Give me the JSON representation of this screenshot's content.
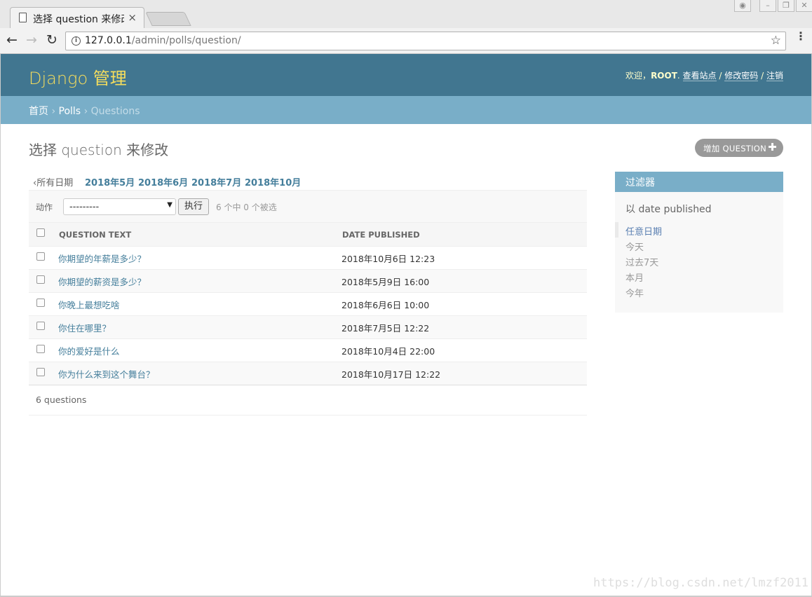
{
  "browser": {
    "tab_title": "选择 question 来修改",
    "tab_close": "×",
    "url_host": "127.0.0.1",
    "url_path": "/admin/polls/question/",
    "info_glyph": "i",
    "back_glyph": "←",
    "forward_glyph": "→",
    "reload_glyph": "↻",
    "star_glyph": "☆",
    "menu_glyph": "⋮",
    "window_controls": {
      "profile": "◉",
      "minimize": "–",
      "maximize": "❐",
      "close": "✕"
    }
  },
  "header": {
    "brand": "Django 管理",
    "welcome": "欢迎，",
    "username": "ROOT",
    "sep_dot": ".",
    "view_site": "查看站点",
    "sep1": "/",
    "change_password": "修改密码",
    "sep2": "/",
    "logout": "注销"
  },
  "breadcrumbs": {
    "home": "首页",
    "sep": "›",
    "app": "Polls",
    "current": "Questions"
  },
  "page": {
    "title": "选择 question 来修改",
    "add_button": "增加 QUESTION",
    "add_icon": "✚"
  },
  "date_hierarchy": {
    "all": "‹所有日期",
    "months": [
      "2018年5月",
      "2018年6月",
      "2018年7月",
      "2018年10月"
    ]
  },
  "actions": {
    "label": "动作",
    "select_value": "---------",
    "caret": "▼",
    "go_button": "执行",
    "counter": "6 个中 0 个被选"
  },
  "table": {
    "columns": [
      "QUESTION TEXT",
      "DATE PUBLISHED"
    ],
    "rows": [
      {
        "question": "你期望的年薪是多少？",
        "date": "2018年10月6日 12:23"
      },
      {
        "question": "你期望的薪资是多少？",
        "date": "2018年5月9日 16:00"
      },
      {
        "question": "你晚上最想吃啥",
        "date": "2018年6月6日 10:00"
      },
      {
        "question": "你住在哪里？",
        "date": "2018年7月5日 12:22"
      },
      {
        "question": "你的爱好是什么",
        "date": "2018年10月4日 22:00"
      },
      {
        "question": "你为什么来到这个舞台？",
        "date": "2018年10月17日 12:22"
      }
    ]
  },
  "paginator": "6 questions",
  "filter": {
    "title": "过滤器",
    "subtitle": "以 date published",
    "options": [
      "任意日期",
      "今天",
      "过去7天",
      "本月",
      "今年"
    ],
    "selected_index": 0
  },
  "watermark": "https://blog.csdn.net/lmzf2011",
  "colors": {
    "header_bg": "#417690",
    "brand": "#f5dd5d",
    "breadcrumb_bg": "#79aec8",
    "link": "#447e9b"
  }
}
